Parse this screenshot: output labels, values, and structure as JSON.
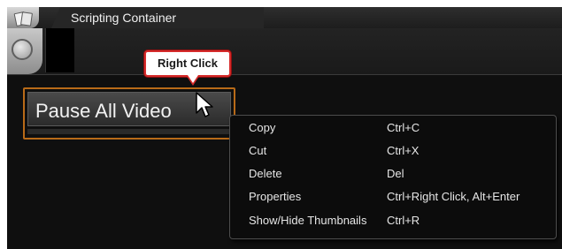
{
  "window": {
    "title": "Scripting Container",
    "app_icon": "pages-icon"
  },
  "toolbar": {
    "round_button_icon": "circle-button-icon"
  },
  "callout": {
    "text": "Right Click",
    "border_color": "#d62b2b"
  },
  "video_button": {
    "label": "Pause All Video",
    "border_color": "#b86a18"
  },
  "cursor": {
    "icon": "arrow-pointer-icon"
  },
  "context_menu": {
    "items": [
      {
        "label": "Copy",
        "shortcut": "Ctrl+C"
      },
      {
        "label": "Cut",
        "shortcut": "Ctrl+X"
      },
      {
        "label": "Delete",
        "shortcut": "Del"
      },
      {
        "label": "Properties",
        "shortcut": "Ctrl+Right Click, Alt+Enter"
      },
      {
        "label": "Show/Hide Thumbnails",
        "shortcut": "Ctrl+R"
      }
    ]
  }
}
